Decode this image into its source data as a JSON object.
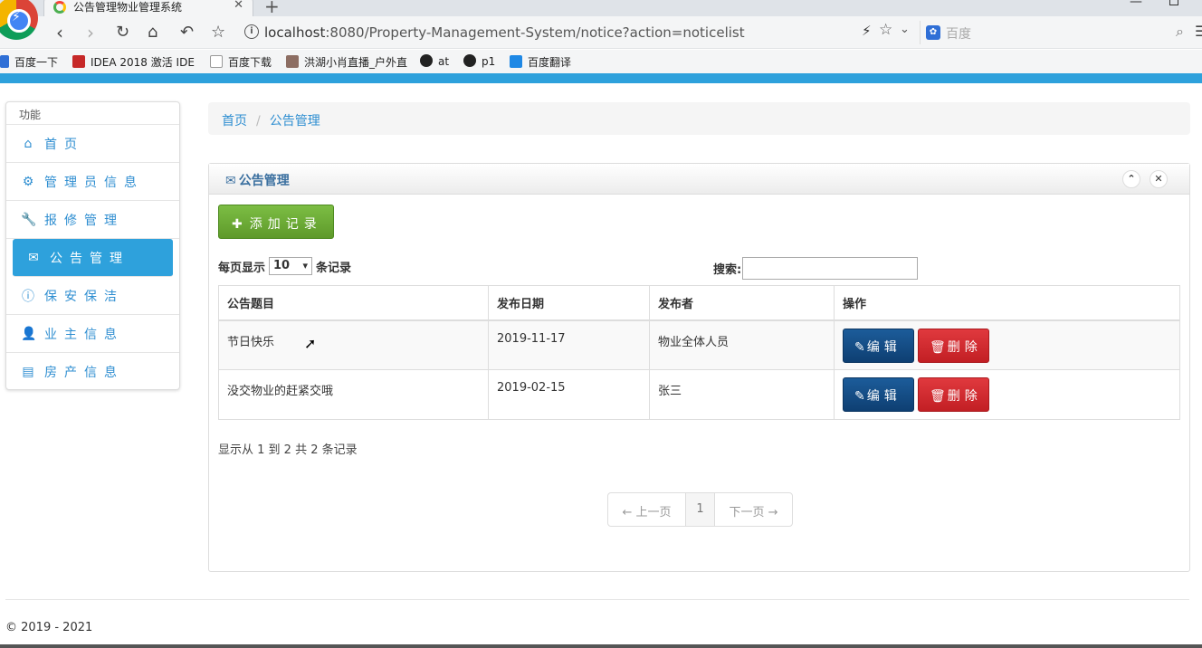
{
  "browser": {
    "tab_title": "公告管理物业管理系统",
    "url_host": "localhost",
    "url_rest": ":8080/Property-Management-System/notice?action=noticelist",
    "search_placeholder": "百度",
    "bookmarks": [
      {
        "label": "百度一下",
        "color": "#2f6fd6"
      },
      {
        "label": "IDEA 2018 激活 IDE",
        "color": "#c62828"
      },
      {
        "label": "百度下载",
        "color": "#9e9e9e"
      },
      {
        "label": "洪湖小肖直播_户外直",
        "color": "#8d6e63"
      },
      {
        "label": "at",
        "color": "#222222"
      },
      {
        "label": "p1",
        "color": "#222222"
      },
      {
        "label": "百度翻译",
        "color": "#1e88e5"
      }
    ]
  },
  "sidebar": {
    "title": "功能",
    "items": [
      {
        "label": "首页",
        "icon": "home-icon"
      },
      {
        "label": "管理员信息",
        "icon": "gear-icon"
      },
      {
        "label": "报修管理",
        "icon": "wrench-icon"
      },
      {
        "label": "公告管理",
        "icon": "envelope-icon"
      },
      {
        "label": "保安保洁",
        "icon": "info-icon"
      },
      {
        "label": "业主信息",
        "icon": "user-icon"
      },
      {
        "label": "房产信息",
        "icon": "list-icon"
      }
    ]
  },
  "breadcrumb": {
    "home": "首页",
    "current": "公告管理"
  },
  "panel": {
    "title": "公告管理",
    "add_button": "添加记录",
    "length_prefix": "每页显示",
    "length_value": "10",
    "length_suffix": "条记录",
    "search_label": "搜索:",
    "columns": [
      "公告题目",
      "发布日期",
      "发布者",
      "操作"
    ],
    "rows": [
      {
        "title": "节日快乐",
        "date": "2019-11-17",
        "publisher": "物业全体人员"
      },
      {
        "title": "没交物业的赶紧交哦",
        "date": "2019-02-15",
        "publisher": "张三"
      }
    ],
    "edit_label": "编辑",
    "delete_label": "删除",
    "info": "显示从 1 到 2 共 2 条记录",
    "pager": {
      "prev": "← 上一页",
      "page": "1",
      "next": "下一页 →"
    }
  },
  "footer": "© 2019 - 2021",
  "colors": {
    "accent": "#2ea1dc",
    "add": "#6aa834",
    "edit": "#0e3f72",
    "delete": "#d2282d"
  }
}
